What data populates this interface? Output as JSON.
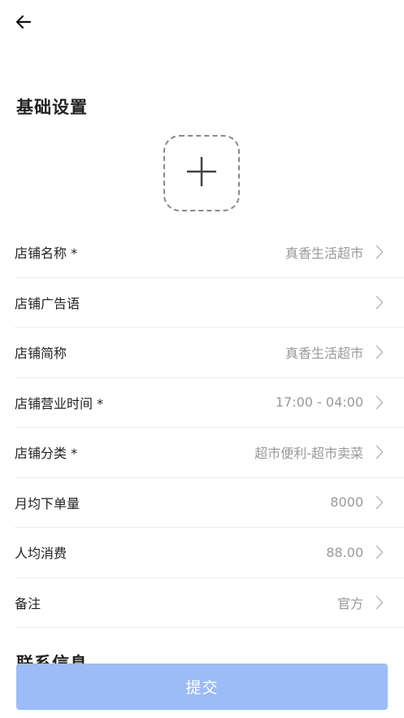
{
  "header": {
    "back_icon": "arrow-left-icon"
  },
  "basic_settings": {
    "title": "基础设置",
    "upload_icon": "plus-icon",
    "fields": [
      {
        "label": "店铺名称 *",
        "value": "真香生活超市"
      },
      {
        "label": "店铺广告语",
        "value": ""
      },
      {
        "label": "店铺简称",
        "value": "真香生活超市"
      },
      {
        "label": "店铺营业时间 *",
        "value": "17:00 - 04:00"
      },
      {
        "label": "店铺分类 *",
        "value": "超市便利-超市卖菜"
      },
      {
        "label": "月均下单量",
        "value": "8000"
      },
      {
        "label": "人均消费",
        "value": "88.00"
      },
      {
        "label": "备注",
        "value": "官方"
      }
    ]
  },
  "contact_info": {
    "title": "联系信息"
  },
  "footer": {
    "submit_label": "提交"
  },
  "colors": {
    "submit_bg": "#9bbcf7",
    "value_text": "#999999",
    "divider": "#ececec"
  }
}
